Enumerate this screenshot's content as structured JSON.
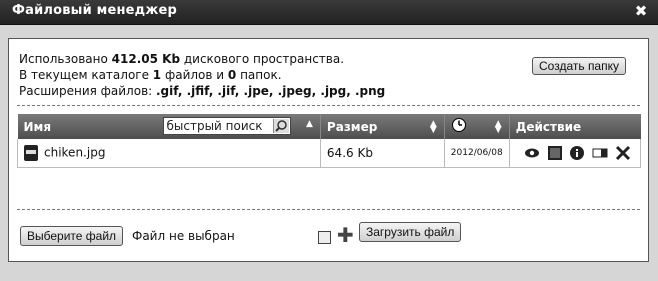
{
  "window": {
    "title": "Файловый менеджер",
    "close_glyph": "✖"
  },
  "info": {
    "line1_prefix": "Использовано ",
    "used": "412.05 Kb",
    "line1_suffix": " дискового пространства.",
    "line2_prefix": "В текущем каталоге ",
    "files_count": "1",
    "line2_mid": " файлов и ",
    "folders_count": "0",
    "line2_suffix": " папок.",
    "ext_prefix": "Расширения файлов: ",
    "extensions": ".gif, .jfif, .jif, .jpe, .jpeg, .jpg, .png"
  },
  "toolbar": {
    "create_folder": "Создать папку"
  },
  "table": {
    "col_name": "Имя",
    "search_placeholder": "быстрый поиск",
    "col_size": "Размер",
    "col_action": "Действие",
    "rows": [
      {
        "name": "chiken.jpg",
        "size": "64.6 Kb",
        "date": "2012/06/08"
      }
    ]
  },
  "icons": {
    "eye": "view-icon",
    "image": "image-icon",
    "info": "info-icon",
    "rename": "rename-icon",
    "delete": "delete-icon"
  },
  "upload": {
    "choose_label": "Выберите файл",
    "no_file": "Файл не выбран",
    "upload_label": "Загрузить файл"
  }
}
